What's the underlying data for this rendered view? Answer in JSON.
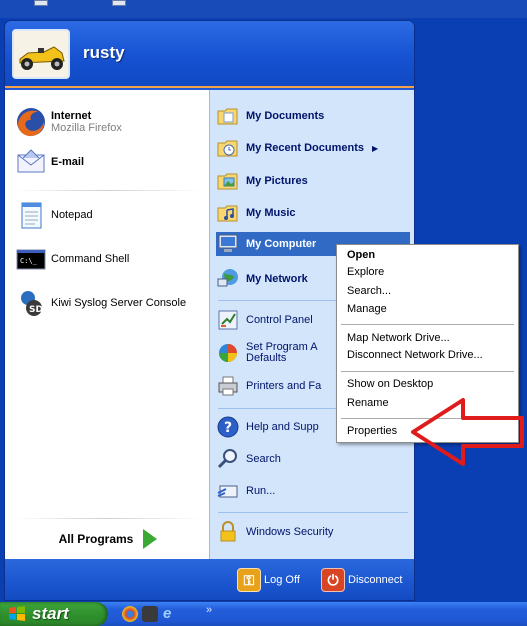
{
  "start_menu": {
    "username": "rusty",
    "pinned": [
      {
        "title": "Internet",
        "subtitle": "Mozilla Firefox",
        "icon": "firefox-icon"
      },
      {
        "title": "E-mail",
        "icon": "email-envelope-icon"
      }
    ],
    "recent": [
      {
        "label": "Notepad",
        "icon": "notepad-icon"
      },
      {
        "label": "Command Shell",
        "icon": "command-prompt-icon"
      },
      {
        "label": "Kiwi Syslog Server Console",
        "icon": "kiwi-syslog-icon"
      }
    ],
    "all_programs": "All Programs",
    "right_items": [
      {
        "label": "My Documents",
        "icon": "folder-documents-icon"
      },
      {
        "label": "My Recent Documents",
        "icon": "recent-documents-icon",
        "submenu_arrow": "▶"
      },
      {
        "label": "My Pictures",
        "icon": "folder-pictures-icon"
      },
      {
        "label": "My Music",
        "icon": "folder-music-icon"
      },
      {
        "label": "My Computer",
        "icon": "my-computer-icon"
      },
      {
        "label": "My Network",
        "icon": "my-network-icon"
      },
      {
        "label": "Control Panel",
        "icon": "control-panel-icon"
      },
      {
        "label": "Set Program A",
        "label2": "Defaults",
        "icon": "program-defaults-icon"
      },
      {
        "label": "Printers and Fa",
        "icon": "printers-icon"
      },
      {
        "label": "Help and Supp",
        "icon": "help-icon"
      },
      {
        "label": "Search",
        "icon": "search-icon"
      },
      {
        "label": "Run...",
        "icon": "run-icon"
      },
      {
        "label": "Windows Security",
        "icon": "windows-security-lock-icon"
      }
    ],
    "footer": {
      "log_off": "Log Off",
      "disconnect": "Disconnect"
    }
  },
  "context_menu": {
    "items": [
      "Open",
      "Explore",
      "Search...",
      "Manage",
      "Map Network Drive...",
      "Disconnect Network Drive...",
      "Show on Desktop",
      "Rename",
      "Properties"
    ],
    "default_item": "Open"
  },
  "taskbar": {
    "start_label": "start",
    "overflow_chevron": "»"
  },
  "colors": {
    "highlight": "#316ac5",
    "menu_blue": "#1f5ad6",
    "right_pane": "#d3e5fa",
    "start_green": "#3a9a36",
    "arrow_red": "#e01b1b"
  }
}
